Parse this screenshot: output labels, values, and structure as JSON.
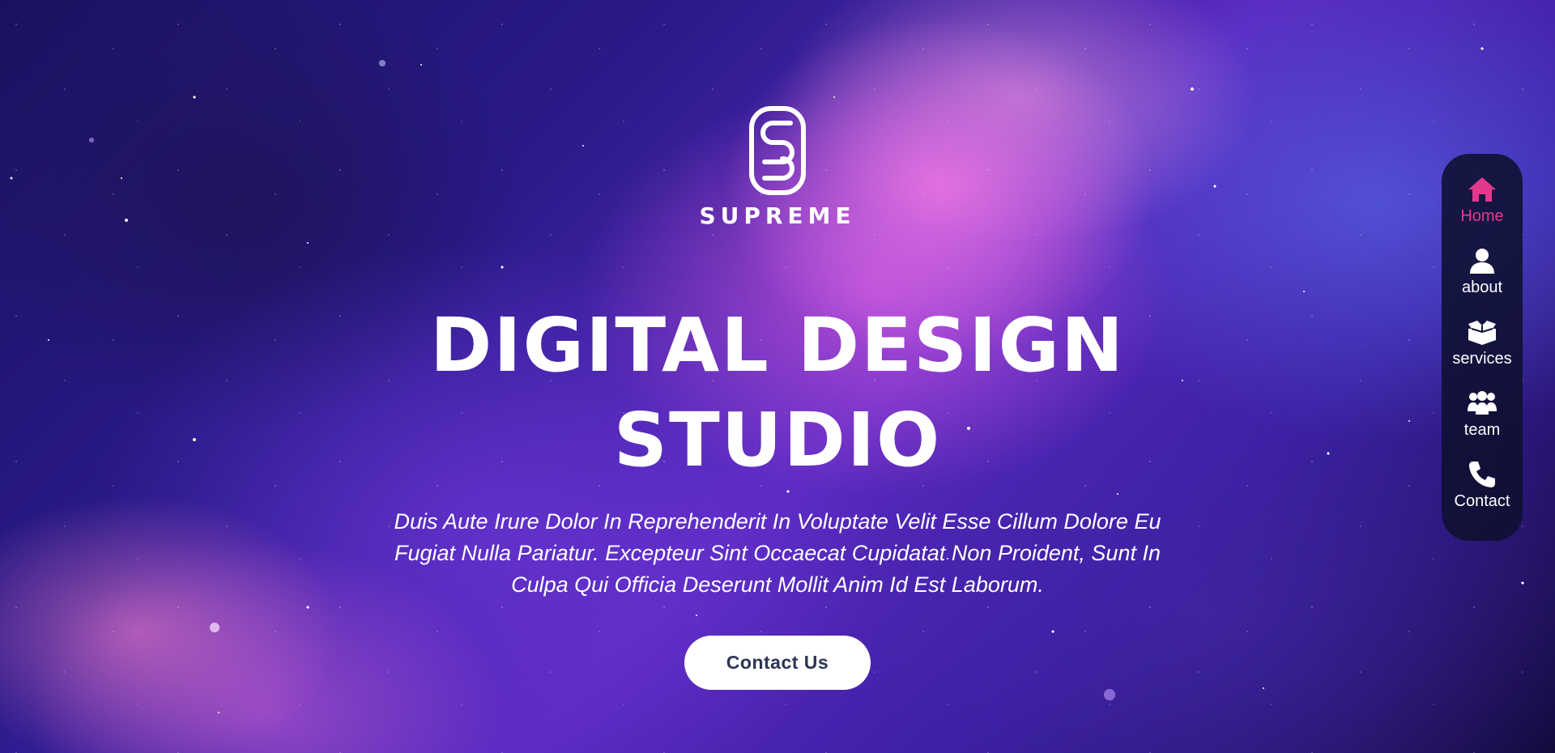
{
  "brand": {
    "name": "SUPREME",
    "logo_icon": "supreme-s-logo"
  },
  "hero": {
    "headline_line1": "DIGITAL DESIGN",
    "headline_line2": "STUDIO",
    "subtext": "Duis Aute Irure Dolor In Reprehenderit In Voluptate Velit Esse Cillum Dolore Eu Fugiat Nulla Pariatur. Excepteur Sint Occaecat Cupidatat Non Proident, Sunt In Culpa Qui Officia Deserunt Mollit Anim Id Est Laborum.",
    "cta_label": "Contact Us"
  },
  "nav": {
    "items": [
      {
        "label": "Home",
        "icon": "home-icon",
        "active": true
      },
      {
        "label": "about",
        "icon": "user-icon",
        "active": false
      },
      {
        "label": "services",
        "icon": "box-icon",
        "active": false
      },
      {
        "label": "team",
        "icon": "team-icon",
        "active": false
      },
      {
        "label": "Contact",
        "icon": "phone-icon",
        "active": false
      }
    ]
  },
  "colors": {
    "accent": "#e2398c",
    "nav_bg": "#0e1030",
    "button_text": "#2c3553",
    "text": "#ffffff"
  }
}
